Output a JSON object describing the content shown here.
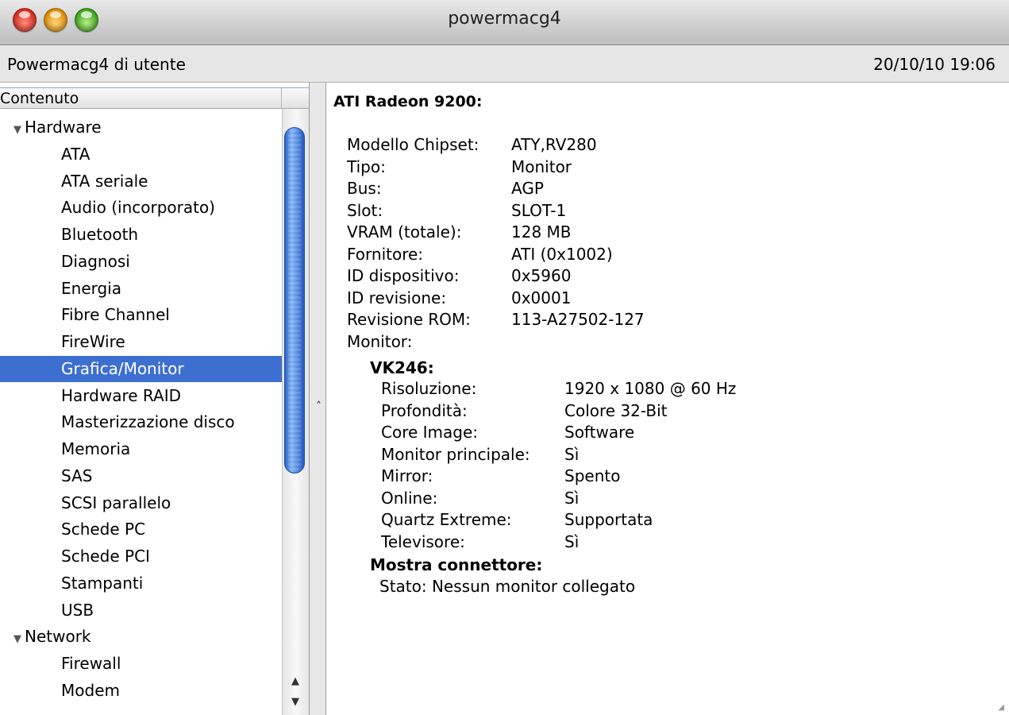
{
  "window": {
    "title": "powermacg4",
    "computer_name": "Powermacg4 di utente",
    "datetime": "20/10/10 19:06"
  },
  "sidebar": {
    "header": "Contenuto",
    "groups": [
      {
        "label": "Hardware",
        "items": [
          "ATA",
          "ATA seriale",
          "Audio (incorporato)",
          "Bluetooth",
          "Diagnosi",
          "Energia",
          "Fibre Channel",
          "FireWire",
          "Grafica/Monitor",
          "Hardware RAID",
          "Masterizzazione disco",
          "Memoria",
          "SAS",
          "SCSI parallelo",
          "Schede PC",
          "Schede PCI",
          "Stampanti",
          "USB"
        ]
      },
      {
        "label": "Network",
        "items": [
          "Firewall",
          "Modem"
        ]
      }
    ],
    "selected_item": "Grafica/Monitor",
    "scroll_up": "▲",
    "scroll_down": "▼"
  },
  "detail": {
    "heading": "ATI Radeon 9200:",
    "properties": [
      {
        "key": "Modello Chipset:",
        "value": "ATY,RV280"
      },
      {
        "key": "Tipo:",
        "value": "Monitor"
      },
      {
        "key": "Bus:",
        "value": "AGP"
      },
      {
        "key": "Slot:",
        "value": "SLOT-1"
      },
      {
        "key": "VRAM (totale):",
        "value": "128 MB"
      },
      {
        "key": "Fornitore:",
        "value": "ATI (0x1002)"
      },
      {
        "key": "ID dispositivo:",
        "value": "0x5960"
      },
      {
        "key": "ID revisione:",
        "value": "0x0001"
      },
      {
        "key": "Revisione ROM:",
        "value": "113-A27502-127"
      },
      {
        "key": "Monitor:",
        "value": ""
      }
    ],
    "monitor": {
      "name": "VK246:",
      "properties": [
        {
          "key": "Risoluzione:",
          "value": "1920 x 1080 @ 60 Hz"
        },
        {
          "key": "Profondità:",
          "value": "Colore 32-Bit"
        },
        {
          "key": "Core Image:",
          "value": "Software"
        },
        {
          "key": "Monitor principale:",
          "value": "Sì"
        },
        {
          "key": "Mirror:",
          "value": "Spento"
        },
        {
          "key": "Online:",
          "value": "Sì"
        },
        {
          "key": "Quartz Extreme:",
          "value": "Supportata"
        },
        {
          "key": "Televisore:",
          "value": "Sì"
        }
      ]
    },
    "connector": {
      "name": "Mostra connettore:",
      "status_key": "Stato:",
      "status_value": "Nessun monitor collegato"
    }
  },
  "colors": {
    "selection": "#3d6fd1",
    "scroll_thumb": "#3a74dc",
    "close": "#e0463a",
    "minimize": "#f0a520",
    "zoom": "#5cbf2e"
  }
}
